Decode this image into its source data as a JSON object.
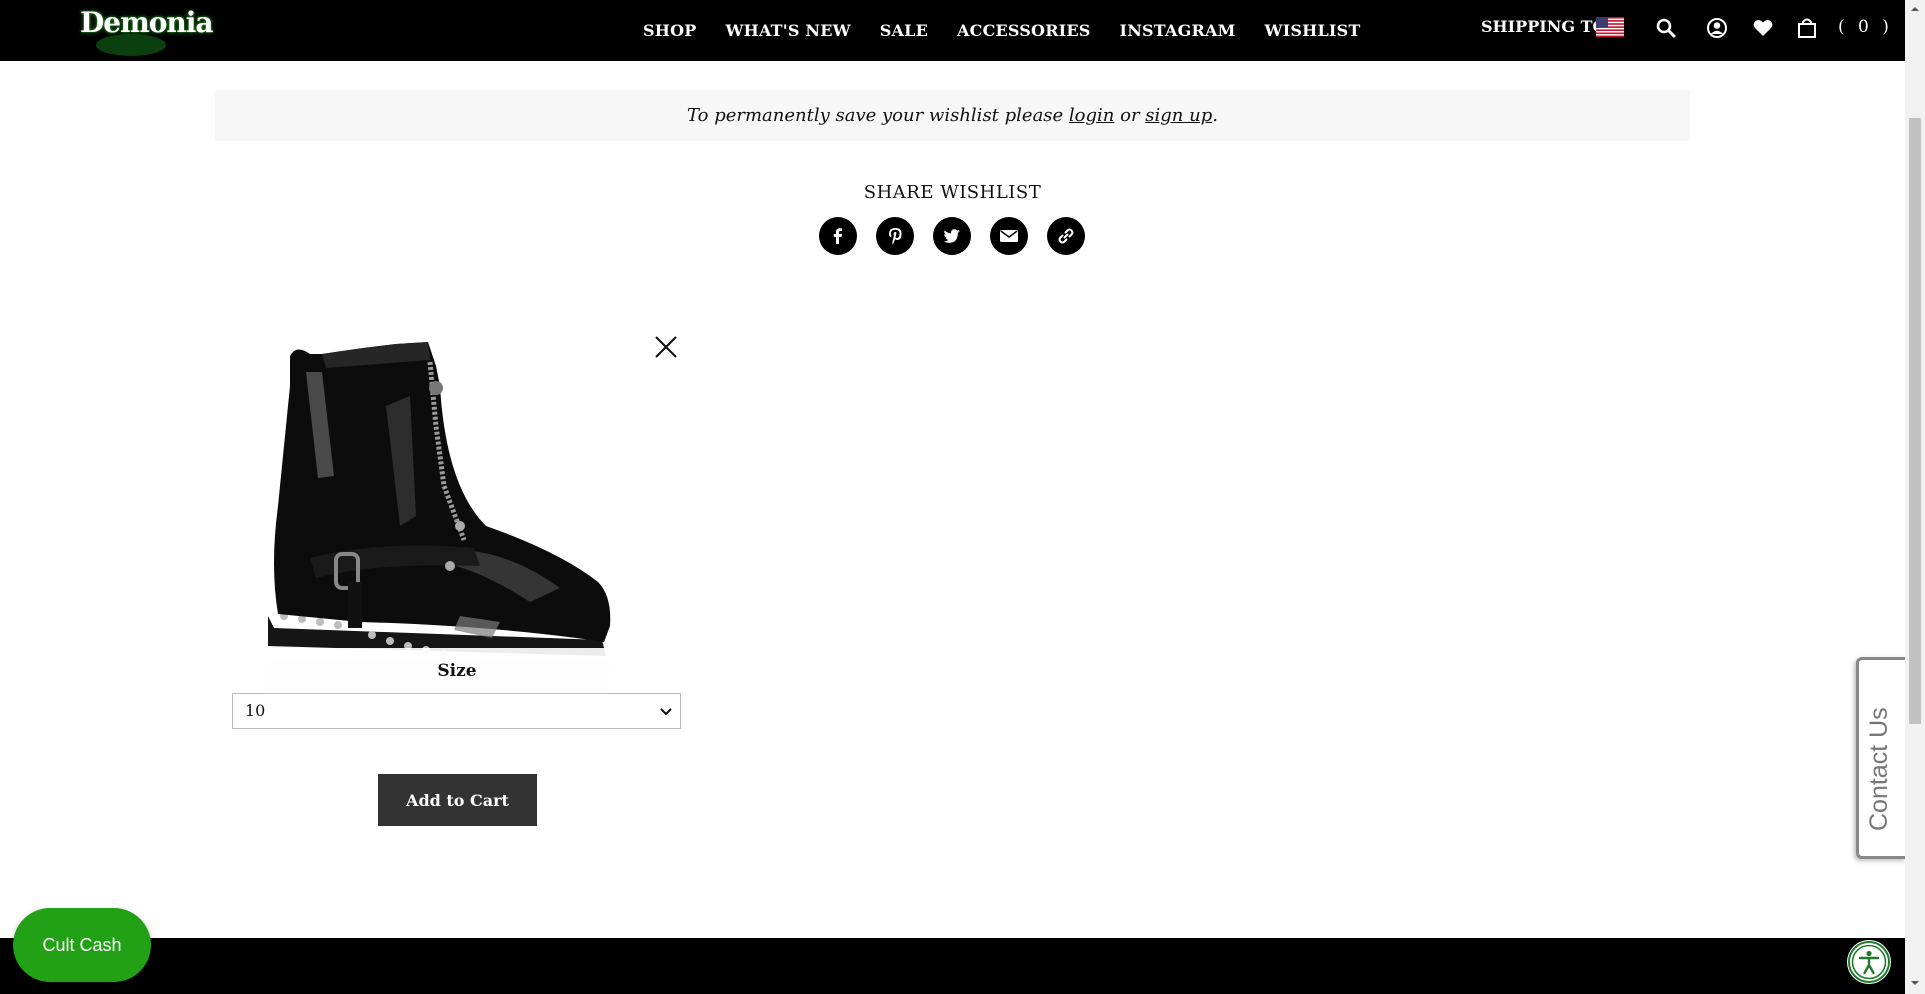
{
  "header": {
    "logo_text": "Demonia",
    "nav": [
      "SHOP",
      "WHAT'S NEW",
      "SALE",
      "ACCESSORIES",
      "INSTAGRAM",
      "WISHLIST"
    ],
    "shipping_label": "SHIPPING TO",
    "cart_count": "( 0 )",
    "icons": [
      "search-icon",
      "account-icon",
      "heart-icon",
      "bag-icon"
    ]
  },
  "wishlist_note": {
    "prefix": "To permanently save your wishlist please ",
    "login": "login",
    "middle": " or ",
    "signup": "sign up",
    "suffix": "."
  },
  "share": {
    "title": "SHARE WISHLIST",
    "icons": [
      "facebook-icon",
      "pinterest-icon",
      "twitter-icon",
      "email-icon",
      "link-icon"
    ]
  },
  "product": {
    "size_label": "Size",
    "size_value": "10",
    "add_to_cart": "Add to Cart"
  },
  "contact_tab": "Contact Us",
  "cult_cash": "Cult Cash",
  "colors": {
    "header_bg": "#000000",
    "accent_green": "#22a016",
    "button_bg": "#333333"
  }
}
